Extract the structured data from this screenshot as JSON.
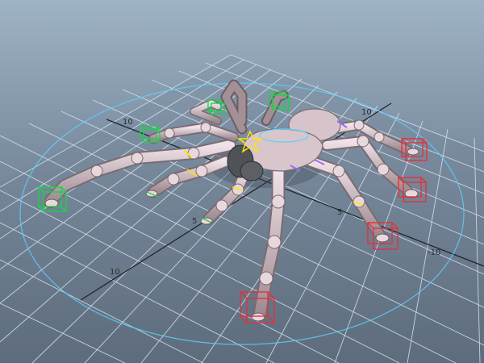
{
  "viewport": {
    "label": "Maya 3D viewport - rigged spider model",
    "grid_labels": {
      "left_axis": "10",
      "top_axis": "10",
      "inner_left": "5",
      "inner_right": "5",
      "bottom_left": "10",
      "right_axis": "-10"
    },
    "colors": {
      "background_top": "#9fb3c6",
      "background_bottom": "#586675",
      "grid_lines": "#d8e6f2",
      "axis_lines": "#1f252d",
      "body": "#d8c6cc",
      "body_shadow": "#7f6f75",
      "ik_control_green": "#19d34a",
      "ik_control_red": "#e2323b",
      "joint_yellow": "#ffe400",
      "outline_blue": "#5bd2ff"
    }
  }
}
